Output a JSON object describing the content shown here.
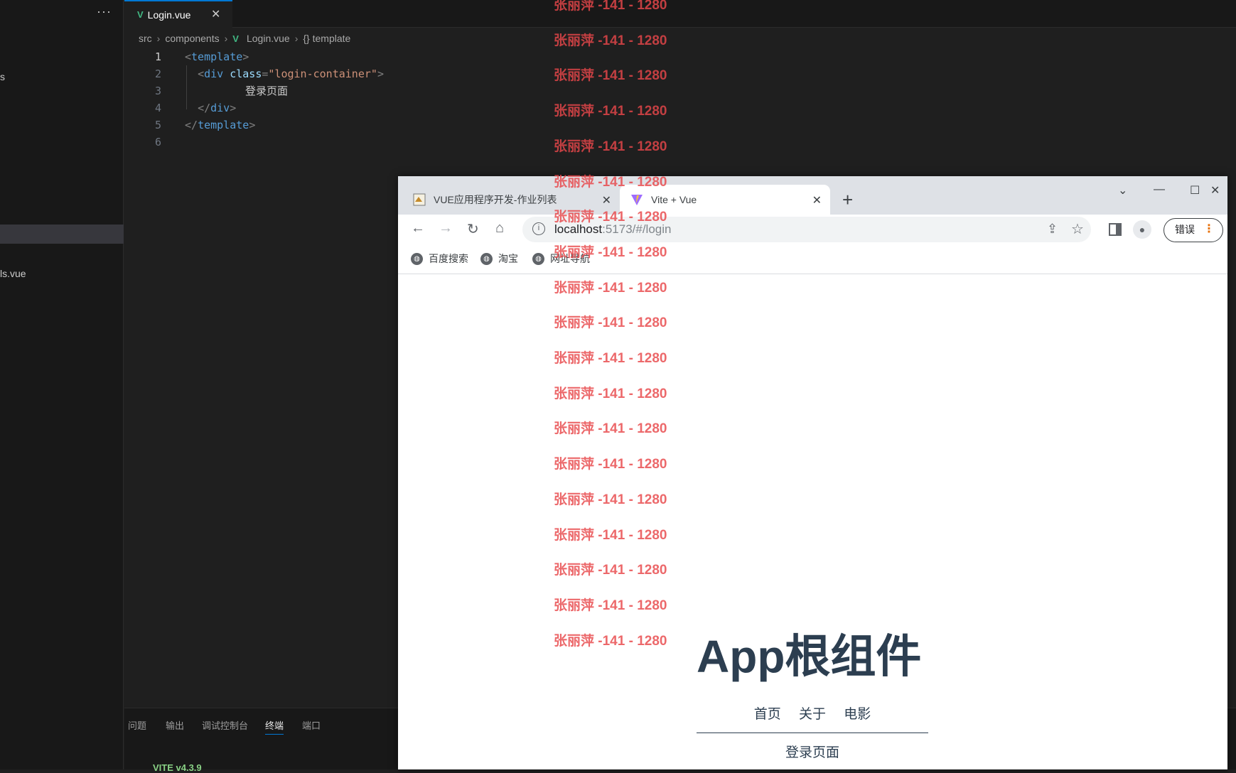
{
  "sidebar": {
    "more": "···",
    "partial_item": "s",
    "file_item": "ls.vue"
  },
  "editor": {
    "tab": {
      "icon": "vue-icon",
      "label": "Login.vue",
      "close": "✕"
    },
    "breadcrumb": [
      "src",
      "components",
      "Login.vue",
      "{} template"
    ],
    "lines": [
      {
        "num": "1",
        "indent": "",
        "parts": [
          [
            "br",
            "<"
          ],
          [
            "tag",
            "template"
          ],
          [
            "br",
            ">"
          ]
        ]
      },
      {
        "num": "2",
        "indent": "  ",
        "parts": [
          [
            "br",
            "<"
          ],
          [
            "tag",
            "div "
          ],
          [
            "att",
            "class"
          ],
          [
            "br",
            "="
          ],
          [
            "str",
            "\"login-container\""
          ],
          [
            "br",
            ">"
          ]
        ]
      },
      {
        "num": "3",
        "indent": "    ",
        "parts": [
          [
            "txt",
            "登录页面"
          ]
        ]
      },
      {
        "num": "4",
        "indent": "  ",
        "parts": [
          [
            "br",
            "</"
          ],
          [
            "tag",
            "div"
          ],
          [
            "br",
            ">"
          ]
        ]
      },
      {
        "num": "5",
        "indent": "",
        "parts": [
          [
            "br",
            "</"
          ],
          [
            "tag",
            "template"
          ],
          [
            "br",
            ">"
          ]
        ]
      },
      {
        "num": "6",
        "indent": "",
        "parts": []
      }
    ]
  },
  "panel": {
    "tabs": [
      "问题",
      "输出",
      "调试控制台",
      "终端",
      "端口"
    ],
    "active": "终端",
    "partial_line": "VITE v4.3.9"
  },
  "browser": {
    "tabs": [
      {
        "title": "VUE应用程序开发-作业列表",
        "icon": "puzzle-icon"
      },
      {
        "title": "Vite + Vue",
        "icon": "vite-icon"
      }
    ],
    "url_host": "localhost",
    "url_path": ":5173/#/login",
    "error_badge": "错误",
    "bookmarks": [
      "百度搜索",
      "淘宝",
      "网址导航"
    ],
    "accent": "#e8710a"
  },
  "page": {
    "app_title": "App根组件",
    "nav": [
      "首页",
      "关于",
      "电影"
    ],
    "content": "登录页面",
    "color": "#2c3e50"
  },
  "watermark": {
    "text": "张丽萍 -141 - 1280",
    "count": 19,
    "color": "#e8474a"
  }
}
